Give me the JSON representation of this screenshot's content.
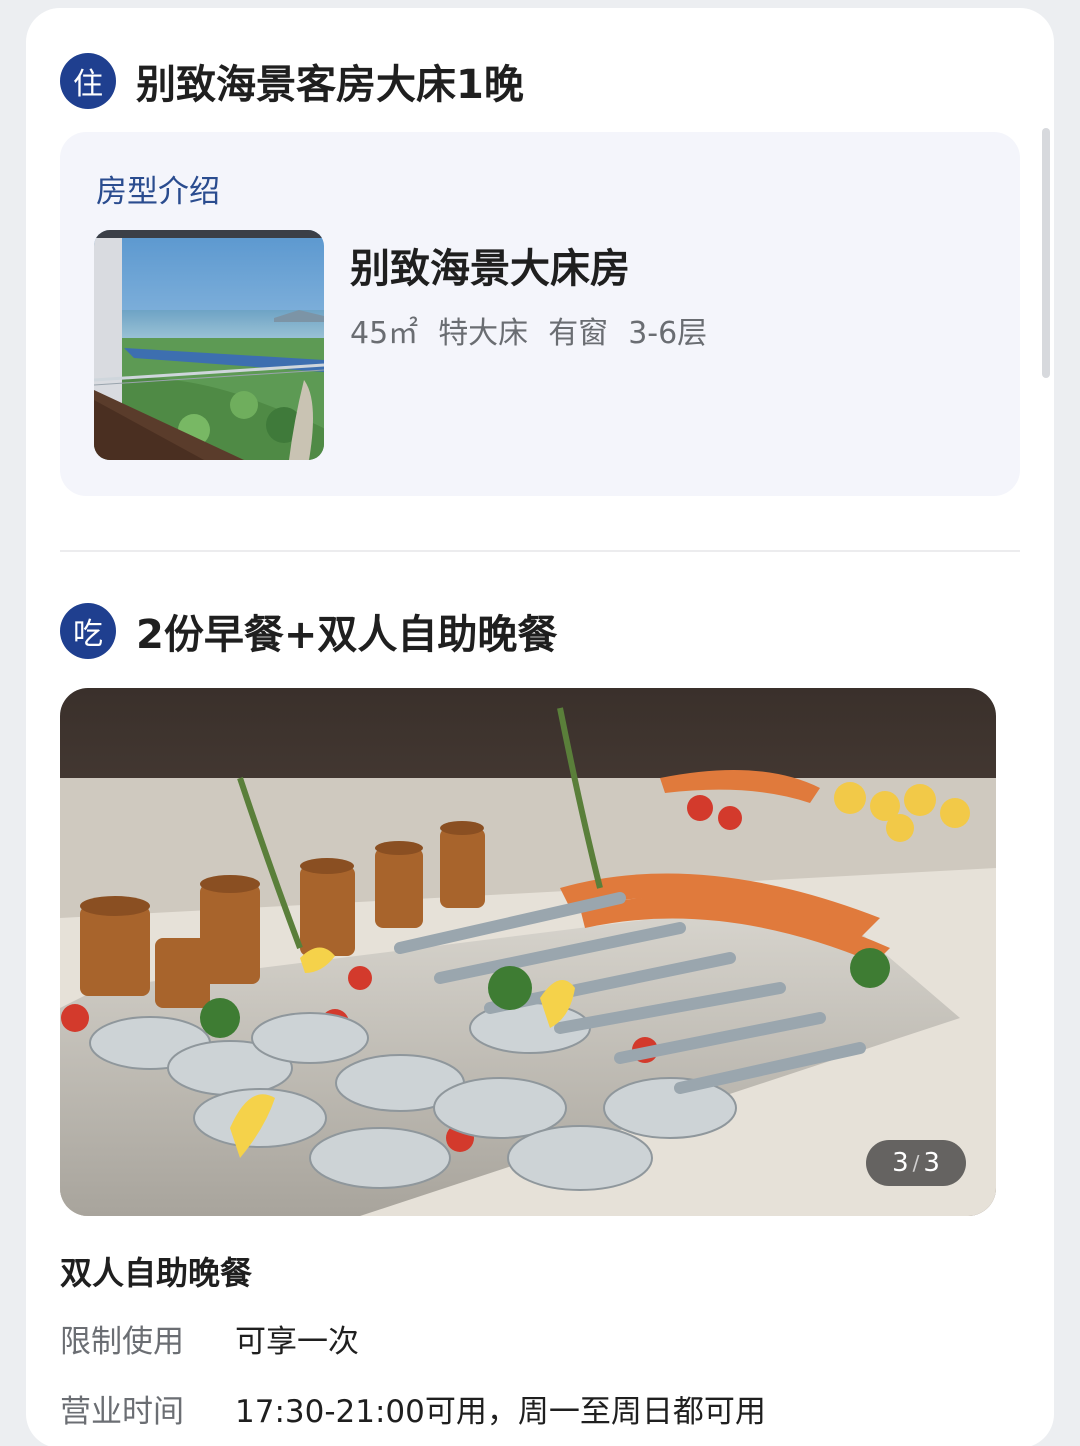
{
  "stay": {
    "badge": "住",
    "title": "别致海景客房大床1晚",
    "room_intro_label": "房型介绍",
    "room": {
      "name": "别致海景大床房",
      "area": "45㎡",
      "bed": "特大床",
      "window": "有窗",
      "floors": "3-6层"
    }
  },
  "eat": {
    "badge": "吃",
    "title": "2份早餐+双人自助晚餐",
    "photo": {
      "current": "3",
      "separator": "/",
      "total": "3"
    },
    "meal_title": "双人自助晚餐",
    "limit": {
      "label": "限制使用",
      "value": "可享一次"
    },
    "hours": {
      "label": "营业时间",
      "value": "17:30-21:00可用，周一至周日都可用"
    }
  },
  "colors": {
    "badge": "#1f3f8f",
    "label_blue": "#2a4c8f",
    "room_box_bg": "#f4f5fb"
  },
  "icons": {
    "room_thumb": "ocean-view-balcony-photo",
    "food_photo": "seafood-buffet-photo"
  }
}
